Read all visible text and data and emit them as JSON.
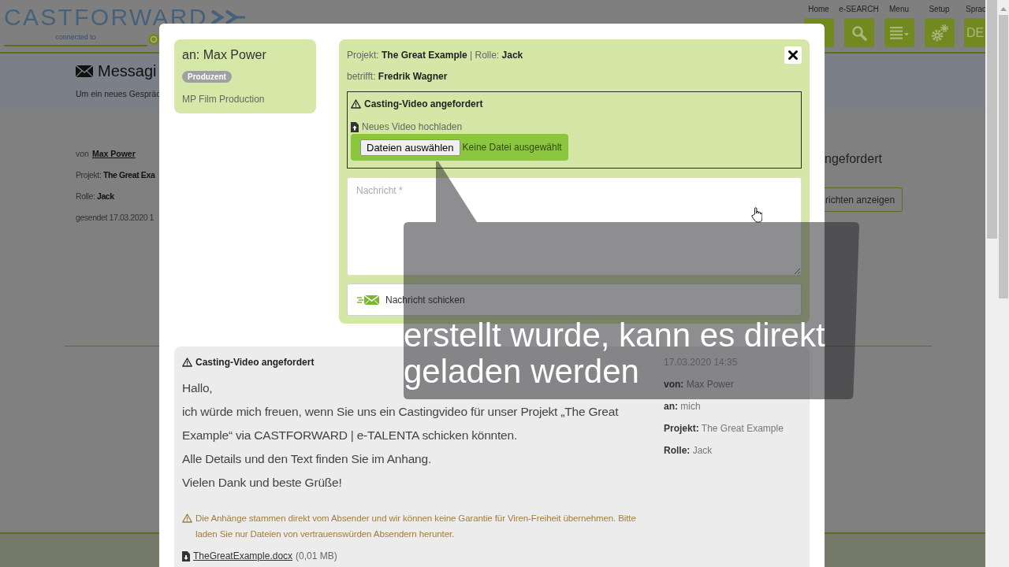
{
  "background_page": {
    "header": {
      "logo": "CASTFORWARD",
      "tagline": "connected to",
      "nav": [
        {
          "label": "Home",
          "kind": "blank"
        },
        {
          "label": "e-SEARCH",
          "kind": "search"
        },
        {
          "label": "Menu",
          "kind": "menu"
        },
        {
          "label": "Setup",
          "kind": "settings"
        },
        {
          "label": "Sprac",
          "kind": "text",
          "text": "DE"
        }
      ]
    },
    "title_band": {
      "heading": "Messagi",
      "hint": "Um ein neues Gespräc"
    },
    "conversation": {
      "sender_label": "von",
      "sender": "Max Power",
      "project": "Projekt: **The Great Exa**",
      "role": "Rolle: **Jack**",
      "sent": "gesendet 17.03.2020 1"
    },
    "side": {
      "subject": "ngefordert",
      "button": "richten anzeigen"
    }
  },
  "dialog": {
    "recipient": {
      "name": "an: Max Power",
      "badge": "Produzent",
      "company": "MP Film Production"
    },
    "compose": {
      "context": "Projekt: **The Great Example** | Rolle: **Jack**",
      "regarding": "betrifft: **Fredrik Wagner**",
      "request": {
        "title": "Casting-Video angefordert",
        "upload_label": "Neues Video hochladen",
        "file_button": "Dateien auswählen",
        "file_status": "Keine Datei ausgewählt"
      },
      "message": {
        "placeholder": "Nachricht *"
      },
      "send_button": "Nachricht schicken"
    },
    "thread": [
      {
        "title": "Casting-Video angefordert",
        "paragraphs": [
          "Hallo,",
          "ich würde mich freuen, wenn Sie uns ein Castingvideo für unser Projekt „The Great Example“ via CASTFORWARD | e-TALENTA schicken könnten.",
          "Alle Details und den Text finden Sie im Anhang.",
          "Vielen Dank und beste Grüße!"
        ],
        "warning": "Die Anhänge stammen direkt vom Absender und wir können keine Garantie für Viren-Freiheit übernehmen. Bitte laden Sie nur Dateien von vertrauenswürden Absendern herunter.",
        "attachment": {
          "name": "TheGreatExample.docx",
          "size": "(0,01 MB)"
        },
        "date": "17.03.2020 14:35",
        "details": [
          "**von:** Max Power",
          "**an:** mich",
          "**Projekt:** The Great Example",
          "**Rolle:** Jack"
        ]
      }
    ]
  },
  "tutorial_callout": {
    "lines": [
      "erstellt wurde, kann es direkt",
      "geladen werden"
    ]
  }
}
